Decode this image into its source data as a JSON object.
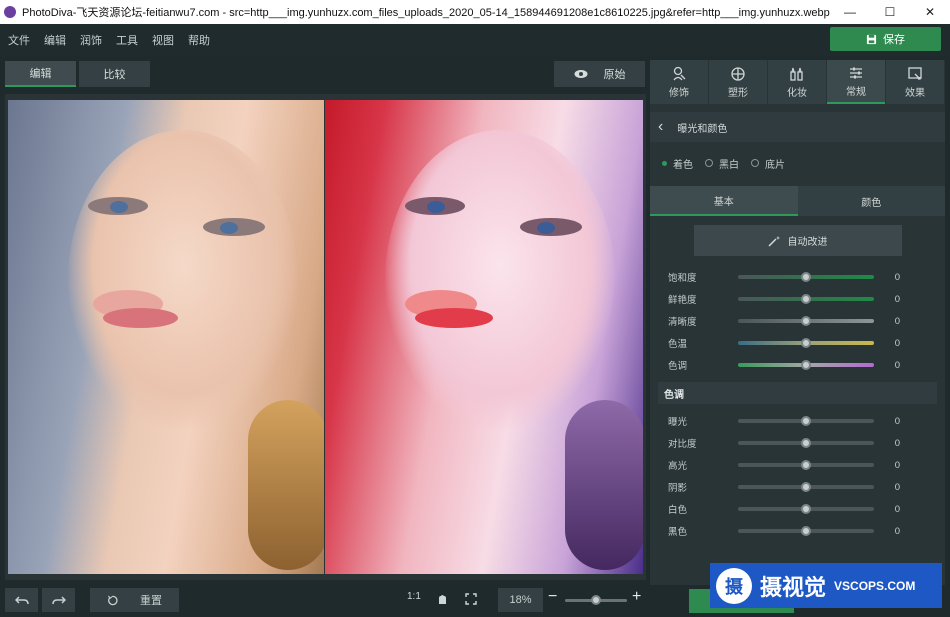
{
  "window": {
    "title": "PhotoDiva-飞天资源论坛-feitianwu7.com - src=http___img.yunhuzx.com_files_uploads_2020_05-14_158944691208e1c8610225.jpg&refer=http___img.yunhuzx.webp.jpg",
    "minimize": "—",
    "maximize": "☐",
    "close": "✕"
  },
  "menu": [
    "文件",
    "编辑",
    "润饰",
    "工具",
    "视图",
    "帮助"
  ],
  "save_button": "保存",
  "toolbar": {
    "edit": "编辑",
    "compare": "比较",
    "original": "原始"
  },
  "tools": [
    {
      "label": "修饰",
      "icon": "retouch-icon"
    },
    {
      "label": "塑形",
      "icon": "reshape-icon"
    },
    {
      "label": "化妆",
      "icon": "makeup-icon"
    },
    {
      "label": "常规",
      "icon": "sliders-icon"
    },
    {
      "label": "效果",
      "icon": "effects-icon"
    }
  ],
  "section": {
    "title": "曝光和颜色",
    "back": "‹"
  },
  "modes": [
    "着色",
    "黑白",
    "底片"
  ],
  "subtabs": [
    "基本",
    "颜色"
  ],
  "auto_button": "自动改进",
  "basic_sliders": [
    {
      "label": "饱和度",
      "value": "0",
      "level": 0.5
    },
    {
      "label": "鲜艳度",
      "value": "0",
      "level": 0.5
    },
    {
      "label": "清晰度",
      "value": "0",
      "level": 0.5
    },
    {
      "label": "色温",
      "value": "0",
      "level": 0.5
    },
    {
      "label": "色调",
      "value": "0",
      "level": 0.5
    }
  ],
  "tone_heading": "色调",
  "tone_sliders": [
    {
      "label": "曝光",
      "value": "0",
      "level": 0.5
    },
    {
      "label": "对比度",
      "value": "0",
      "level": 0.5
    },
    {
      "label": "高光",
      "value": "0",
      "level": 0.5
    },
    {
      "label": "阴影",
      "value": "0",
      "level": 0.5
    },
    {
      "label": "白色",
      "value": "0",
      "level": 0.5
    },
    {
      "label": "黑色",
      "value": "0",
      "level": 0.5
    }
  ],
  "bottom": {
    "reset": "重置",
    "ratio": "1:1",
    "zoom": "18%",
    "zoom_level": 0.5
  },
  "watermark": {
    "logo": "摄",
    "brand": "摄视觉",
    "url": "VSCOPS.COM"
  },
  "colors": {
    "accent": "#2e9a5a",
    "save": "#2e8a4e"
  }
}
